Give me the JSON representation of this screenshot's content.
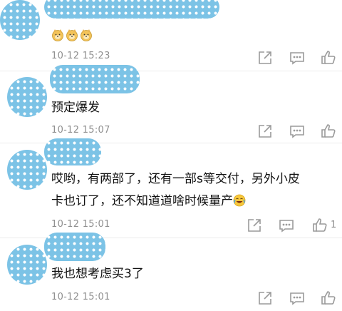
{
  "comments": [
    {
      "text": "",
      "emoji": [
        "doge-icon",
        "doge-icon",
        "doge-icon"
      ],
      "time": "10-12 15:23",
      "like_count": ""
    },
    {
      "text": "预定爆发",
      "time": "10-12 15:07",
      "like_count": ""
    },
    {
      "text_line1": "哎哟，有两部了，还有一部s等交付，另外小皮",
      "text_line2": "卡也订了，还不知道道啥时候量产",
      "emoji": "laughing-tears-icon",
      "time": "10-12 15:01",
      "like_count": "1"
    },
    {
      "text": "我也想考虑买3了",
      "time": "10-12 15:01",
      "like_count": ""
    }
  ],
  "colors": {
    "avatar_blue": "#7cc3e6",
    "meta_gray": "#8f8f8f"
  }
}
